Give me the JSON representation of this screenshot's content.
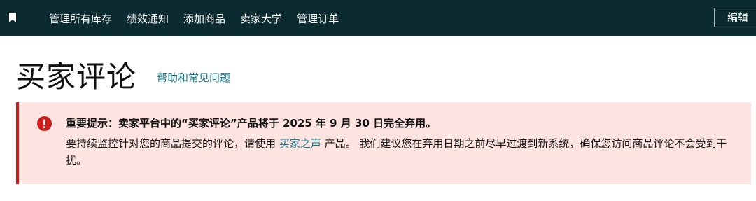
{
  "header": {
    "nav_items": [
      "管理所有库存",
      "绩效通知",
      "添加商品",
      "卖家大学",
      "管理订单"
    ],
    "edit_label": "编辑",
    "bookmark_icon": "bookmark-icon",
    "background_color": "#0b2b31"
  },
  "page": {
    "title": "买家评论",
    "help_link": "帮助和常见问题"
  },
  "alert": {
    "icon": "alert-error-icon",
    "heading": "重要提示：卖家平台中的“买家评论”产品将于 2025 年 9 月 30 日完全弃用。",
    "body_before_link": "要持续监控针对您的商品提交的评论，请使用 ",
    "link_text": "买家之声",
    "body_after_link": " 产品。 我们建议您在弃用日期之前尽早过渡到新系统，确保您访问商品评论不会受到干扰。",
    "background_color": "#fde4e1",
    "accent_color": "#cc1c1c"
  }
}
